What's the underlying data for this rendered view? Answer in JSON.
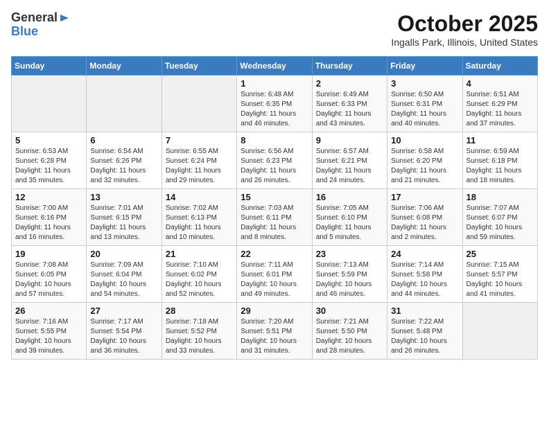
{
  "header": {
    "logo_general": "General",
    "logo_blue": "Blue",
    "month_title": "October 2025",
    "location": "Ingalls Park, Illinois, United States"
  },
  "weekdays": [
    "Sunday",
    "Monday",
    "Tuesday",
    "Wednesday",
    "Thursday",
    "Friday",
    "Saturday"
  ],
  "weeks": [
    [
      {
        "day": "",
        "sunrise": "",
        "sunset": "",
        "daylight": ""
      },
      {
        "day": "",
        "sunrise": "",
        "sunset": "",
        "daylight": ""
      },
      {
        "day": "",
        "sunrise": "",
        "sunset": "",
        "daylight": ""
      },
      {
        "day": "1",
        "sunrise": "Sunrise: 6:48 AM",
        "sunset": "Sunset: 6:35 PM",
        "daylight": "Daylight: 11 hours and 46 minutes."
      },
      {
        "day": "2",
        "sunrise": "Sunrise: 6:49 AM",
        "sunset": "Sunset: 6:33 PM",
        "daylight": "Daylight: 11 hours and 43 minutes."
      },
      {
        "day": "3",
        "sunrise": "Sunrise: 6:50 AM",
        "sunset": "Sunset: 6:31 PM",
        "daylight": "Daylight: 11 hours and 40 minutes."
      },
      {
        "day": "4",
        "sunrise": "Sunrise: 6:51 AM",
        "sunset": "Sunset: 6:29 PM",
        "daylight": "Daylight: 11 hours and 37 minutes."
      }
    ],
    [
      {
        "day": "5",
        "sunrise": "Sunrise: 6:53 AM",
        "sunset": "Sunset: 6:28 PM",
        "daylight": "Daylight: 11 hours and 35 minutes."
      },
      {
        "day": "6",
        "sunrise": "Sunrise: 6:54 AM",
        "sunset": "Sunset: 6:26 PM",
        "daylight": "Daylight: 11 hours and 32 minutes."
      },
      {
        "day": "7",
        "sunrise": "Sunrise: 6:55 AM",
        "sunset": "Sunset: 6:24 PM",
        "daylight": "Daylight: 11 hours and 29 minutes."
      },
      {
        "day": "8",
        "sunrise": "Sunrise: 6:56 AM",
        "sunset": "Sunset: 6:23 PM",
        "daylight": "Daylight: 11 hours and 26 minutes."
      },
      {
        "day": "9",
        "sunrise": "Sunrise: 6:57 AM",
        "sunset": "Sunset: 6:21 PM",
        "daylight": "Daylight: 11 hours and 24 minutes."
      },
      {
        "day": "10",
        "sunrise": "Sunrise: 6:58 AM",
        "sunset": "Sunset: 6:20 PM",
        "daylight": "Daylight: 11 hours and 21 minutes."
      },
      {
        "day": "11",
        "sunrise": "Sunrise: 6:59 AM",
        "sunset": "Sunset: 6:18 PM",
        "daylight": "Daylight: 11 hours and 18 minutes."
      }
    ],
    [
      {
        "day": "12",
        "sunrise": "Sunrise: 7:00 AM",
        "sunset": "Sunset: 6:16 PM",
        "daylight": "Daylight: 11 hours and 16 minutes."
      },
      {
        "day": "13",
        "sunrise": "Sunrise: 7:01 AM",
        "sunset": "Sunset: 6:15 PM",
        "daylight": "Daylight: 11 hours and 13 minutes."
      },
      {
        "day": "14",
        "sunrise": "Sunrise: 7:02 AM",
        "sunset": "Sunset: 6:13 PM",
        "daylight": "Daylight: 11 hours and 10 minutes."
      },
      {
        "day": "15",
        "sunrise": "Sunrise: 7:03 AM",
        "sunset": "Sunset: 6:11 PM",
        "daylight": "Daylight: 11 hours and 8 minutes."
      },
      {
        "day": "16",
        "sunrise": "Sunrise: 7:05 AM",
        "sunset": "Sunset: 6:10 PM",
        "daylight": "Daylight: 11 hours and 5 minutes."
      },
      {
        "day": "17",
        "sunrise": "Sunrise: 7:06 AM",
        "sunset": "Sunset: 6:08 PM",
        "daylight": "Daylight: 11 hours and 2 minutes."
      },
      {
        "day": "18",
        "sunrise": "Sunrise: 7:07 AM",
        "sunset": "Sunset: 6:07 PM",
        "daylight": "Daylight: 10 hours and 59 minutes."
      }
    ],
    [
      {
        "day": "19",
        "sunrise": "Sunrise: 7:08 AM",
        "sunset": "Sunset: 6:05 PM",
        "daylight": "Daylight: 10 hours and 57 minutes."
      },
      {
        "day": "20",
        "sunrise": "Sunrise: 7:09 AM",
        "sunset": "Sunset: 6:04 PM",
        "daylight": "Daylight: 10 hours and 54 minutes."
      },
      {
        "day": "21",
        "sunrise": "Sunrise: 7:10 AM",
        "sunset": "Sunset: 6:02 PM",
        "daylight": "Daylight: 10 hours and 52 minutes."
      },
      {
        "day": "22",
        "sunrise": "Sunrise: 7:11 AM",
        "sunset": "Sunset: 6:01 PM",
        "daylight": "Daylight: 10 hours and 49 minutes."
      },
      {
        "day": "23",
        "sunrise": "Sunrise: 7:13 AM",
        "sunset": "Sunset: 5:59 PM",
        "daylight": "Daylight: 10 hours and 46 minutes."
      },
      {
        "day": "24",
        "sunrise": "Sunrise: 7:14 AM",
        "sunset": "Sunset: 5:58 PM",
        "daylight": "Daylight: 10 hours and 44 minutes."
      },
      {
        "day": "25",
        "sunrise": "Sunrise: 7:15 AM",
        "sunset": "Sunset: 5:57 PM",
        "daylight": "Daylight: 10 hours and 41 minutes."
      }
    ],
    [
      {
        "day": "26",
        "sunrise": "Sunrise: 7:16 AM",
        "sunset": "Sunset: 5:55 PM",
        "daylight": "Daylight: 10 hours and 39 minutes."
      },
      {
        "day": "27",
        "sunrise": "Sunrise: 7:17 AM",
        "sunset": "Sunset: 5:54 PM",
        "daylight": "Daylight: 10 hours and 36 minutes."
      },
      {
        "day": "28",
        "sunrise": "Sunrise: 7:18 AM",
        "sunset": "Sunset: 5:52 PM",
        "daylight": "Daylight: 10 hours and 33 minutes."
      },
      {
        "day": "29",
        "sunrise": "Sunrise: 7:20 AM",
        "sunset": "Sunset: 5:51 PM",
        "daylight": "Daylight: 10 hours and 31 minutes."
      },
      {
        "day": "30",
        "sunrise": "Sunrise: 7:21 AM",
        "sunset": "Sunset: 5:50 PM",
        "daylight": "Daylight: 10 hours and 28 minutes."
      },
      {
        "day": "31",
        "sunrise": "Sunrise: 7:22 AM",
        "sunset": "Sunset: 5:48 PM",
        "daylight": "Daylight: 10 hours and 26 minutes."
      },
      {
        "day": "",
        "sunrise": "",
        "sunset": "",
        "daylight": ""
      }
    ]
  ]
}
